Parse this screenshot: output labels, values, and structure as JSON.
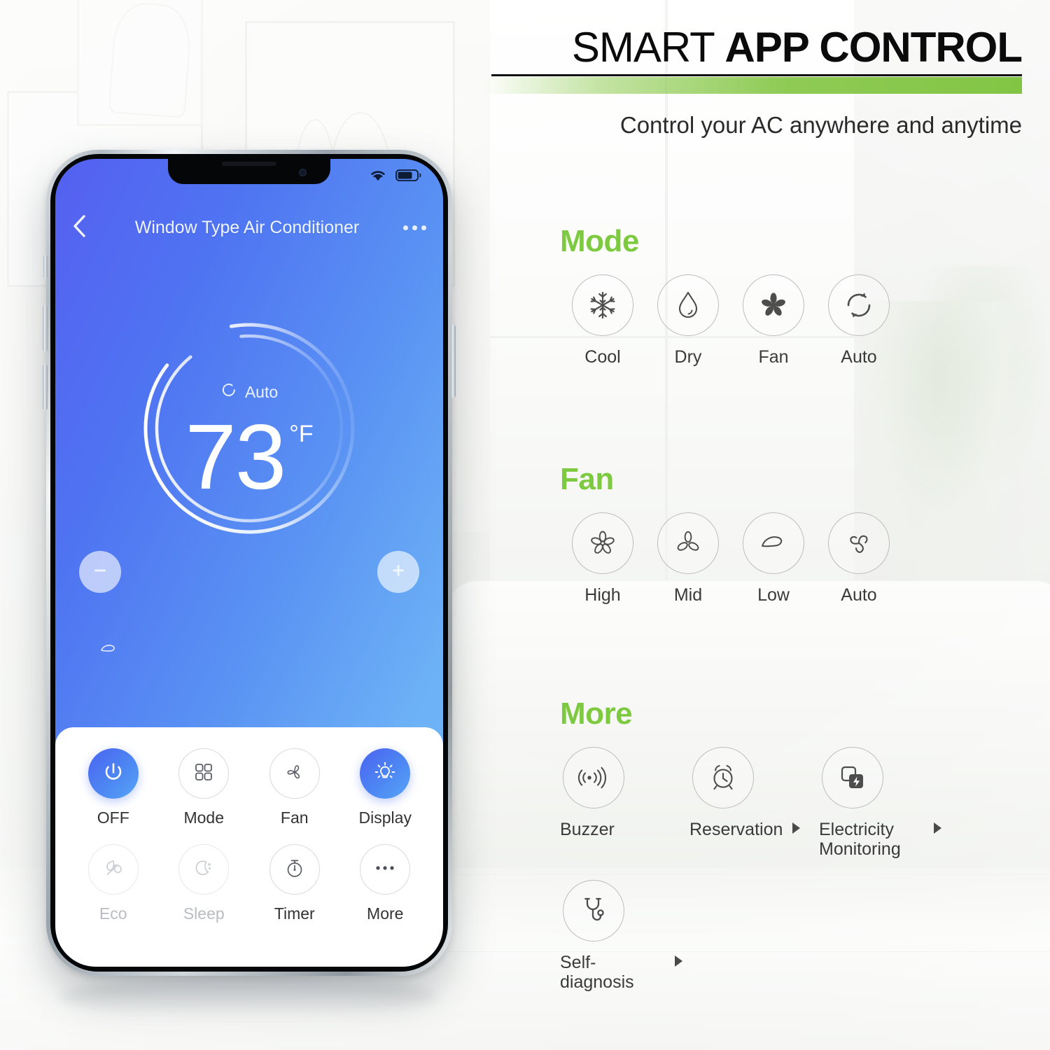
{
  "header": {
    "title_light": "SMART ",
    "title_bold": "APP CONTROL",
    "subtitle": "Control your AC anywhere and anytime",
    "accent_green": "#7dc93f",
    "rule_black": "#111111"
  },
  "phone": {
    "statusbar": {
      "wifi_icon": "wifi-icon",
      "battery_icon": "battery-icon"
    },
    "appbar": {
      "back_icon": "back-chevron-icon",
      "title": "Window Type Air Conditioner",
      "more_icon": "overflow-dots-icon"
    },
    "dial": {
      "mode_icon": "auto-refresh-icon",
      "mode_label": "Auto",
      "temperature": "73",
      "unit": "°F",
      "decrease_icon": "minus-icon",
      "increase_icon": "plus-icon",
      "wind_indicator_icon": "low-wind-icon"
    },
    "controls": [
      {
        "label": "OFF",
        "icon": "power-icon",
        "state": "active"
      },
      {
        "label": "Mode",
        "icon": "grid-mode-icon",
        "state": "normal"
      },
      {
        "label": "Fan",
        "icon": "fan-blade-icon",
        "state": "normal"
      },
      {
        "label": "Display",
        "icon": "bulb-icon",
        "state": "active"
      },
      {
        "label": "Eco",
        "icon": "leaf-icon",
        "state": "disabled"
      },
      {
        "label": "Sleep",
        "icon": "moon-stars-icon",
        "state": "disabled"
      },
      {
        "label": "Timer",
        "icon": "stopwatch-icon",
        "state": "normal"
      },
      {
        "label": "More",
        "icon": "ellipsis-icon",
        "state": "normal"
      }
    ]
  },
  "sections": {
    "mode": {
      "title": "Mode",
      "items": [
        {
          "label": "Cool",
          "icon": "snowflake-icon"
        },
        {
          "label": "Dry",
          "icon": "water-drop-icon"
        },
        {
          "label": "Fan",
          "icon": "fan-filled-icon"
        },
        {
          "label": "Auto",
          "icon": "auto-cycle-icon"
        }
      ]
    },
    "fan": {
      "title": "Fan",
      "items": [
        {
          "label": "High",
          "icon": "fan-five-blade-icon"
        },
        {
          "label": "Mid",
          "icon": "fan-three-blade-icon"
        },
        {
          "label": "Low",
          "icon": "single-blade-icon"
        },
        {
          "label": "Auto",
          "icon": "fan-spiral-icon"
        }
      ]
    },
    "more": {
      "title": "More",
      "items": [
        {
          "label": "Buzzer",
          "icon": "sound-wave-icon",
          "arrow": false
        },
        {
          "label": "Reservation",
          "icon": "alarm-clock-icon",
          "arrow": true
        },
        {
          "label": "Electricity Monitoring",
          "icon": "power-meter-icon",
          "arrow": true
        },
        {
          "label": "Self-diagnosis",
          "icon": "stethoscope-icon",
          "arrow": true
        }
      ]
    }
  }
}
